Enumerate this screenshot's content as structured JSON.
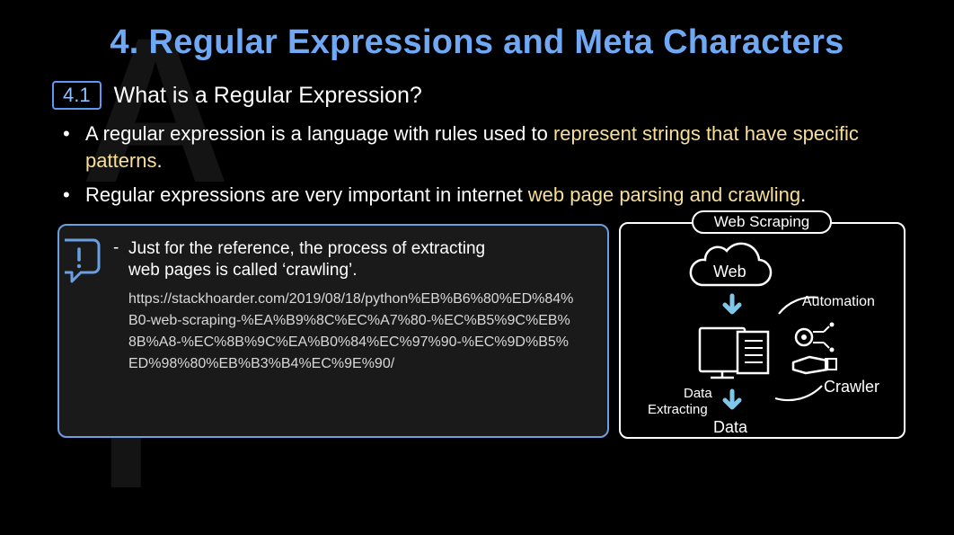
{
  "title": "4. Regular Expressions and Meta Characters",
  "section": {
    "number": "4.1",
    "title": "What is a Regular Expression?"
  },
  "bullets": [
    {
      "text_before": "A regular expression is a language with rules used to ",
      "highlight": "represent strings that have specific patterns",
      "text_after": "."
    },
    {
      "text_before": "Regular expressions are very important in internet ",
      "highlight": "web page parsing and crawling",
      "text_after": "."
    }
  ],
  "note": {
    "dash": "-",
    "line1": "Just for the reference, the process of extracting",
    "line2": "web pages is called ‘crawling’.",
    "url": "https://stackhoarder.com/2019/08/18/python%EB%B6%80%ED%84%B0-web-scraping-%EA%B9%8C%EC%A7%80-%EC%B5%9C%EB%8B%A8-%EC%8B%9C%EA%B0%84%EC%97%90-%EC%9D%B5%ED%98%80%EB%B3%B4%EC%9E%90/"
  },
  "diagram": {
    "tag": "Web Scraping",
    "cloud_label": "Web",
    "automation": "Automation",
    "crawler": "Crawler",
    "extract1": "Data",
    "extract2": "Extracting",
    "data": "Data",
    "colors": {
      "arrow": "#7fc6ea",
      "icon": "#ffffff",
      "title": "#6fa8f5",
      "highlight": "#f7df9a"
    }
  }
}
